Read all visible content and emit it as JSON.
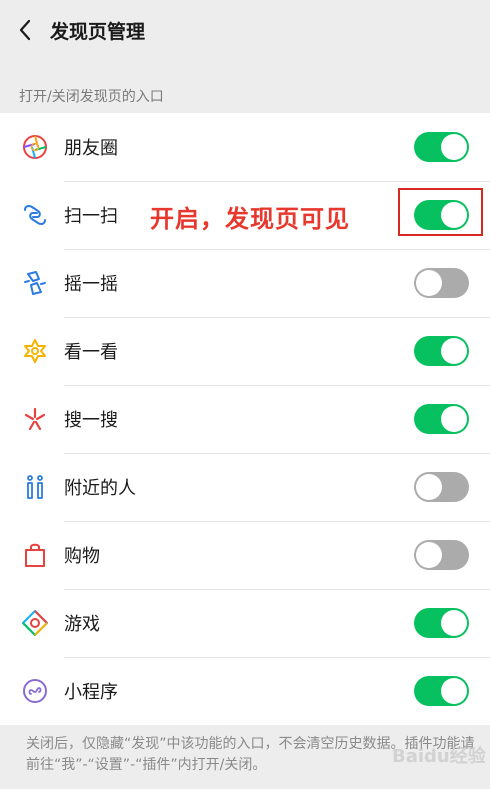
{
  "header": {
    "title": "发现页管理"
  },
  "section_caption": "打开/关闭发现页的入口",
  "colors": {
    "accent": "#07c160",
    "toggle_off": "#ababab",
    "annotation": "#e8382d"
  },
  "items": [
    {
      "label": "朋友圈",
      "icon": "moments-icon",
      "enabled": true
    },
    {
      "label": "扫一扫",
      "icon": "scan-icon",
      "enabled": true
    },
    {
      "label": "摇一摇",
      "icon": "shake-icon",
      "enabled": false
    },
    {
      "label": "看一看",
      "icon": "top-stories-icon",
      "enabled": true
    },
    {
      "label": "搜一搜",
      "icon": "search-icon",
      "enabled": true
    },
    {
      "label": "附近的人",
      "icon": "people-nearby-icon",
      "enabled": false
    },
    {
      "label": "购物",
      "icon": "shopping-bag-icon",
      "enabled": false
    },
    {
      "label": "游戏",
      "icon": "games-icon",
      "enabled": true
    },
    {
      "label": "小程序",
      "icon": "mini-programs-icon",
      "enabled": true
    }
  ],
  "annotation": {
    "text": "开启，发现页可见"
  },
  "footer_note": "关闭后，仅隐藏“发现”中该功能的入口，不会清空历史数据。插件功能请前往“我”-“设置”-“插件”内打开/关闭。",
  "watermark": "Baidu经验"
}
